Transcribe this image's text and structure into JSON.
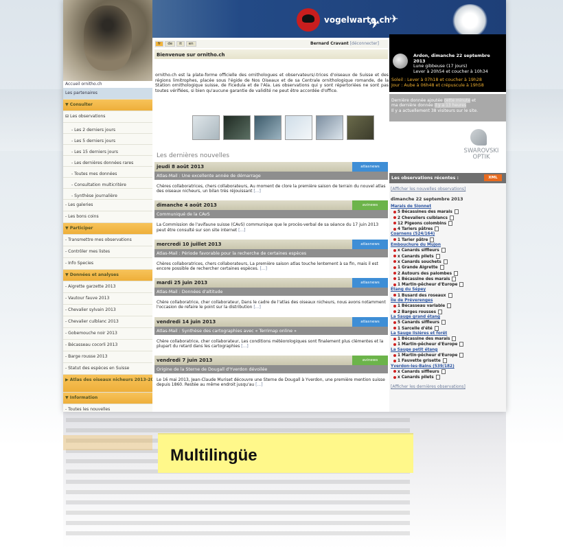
{
  "header": {
    "brand": "vogelwarte.ch"
  },
  "langbar": {
    "languages": [
      "fr",
      "de",
      "it",
      "en"
    ],
    "user": "Bernard Cravant",
    "logout": "[déconnecter]"
  },
  "welcome": {
    "title": "Bienvenue sur ornitho.ch",
    "intro": "ornitho.ch est la plate-forme officielle des ornithologues et observateurs/-trices d'oiseaux de Suisse et des régions limitrophes, placée sous l'égide de Nos Oiseaux et de sa Centrale ornithologique romande, de la Station ornithologique suisse, de Ficedula et de l'Ala. Les observations qui y sont répertoriées ne sont pas toutes vérifiées, si bien qu'aucune garantie de validité ne peut être accordée d'office."
  },
  "nav": {
    "home": "Accueil ornitho.ch",
    "partners": "Les partenaires",
    "consulter": "▼ Consulter",
    "observations": "⊟ Les observations",
    "items1": [
      "- Les 2 derniers jours",
      "- Les 5 derniers jours",
      "- Les 15 derniers jours",
      "- Les dernières données rares",
      "- Toutes mes données",
      "- Consultation multicritère",
      "- Synthèse journalière"
    ],
    "galleries": "- Les galeries",
    "bonscoins": "- Les bons coins",
    "participer": "▼ Participer",
    "items2": [
      "- Transmettre mes observations",
      "- Contrôler mes listes",
      "- Info Species"
    ],
    "donnees": "▼ Données et analyses",
    "items3": [
      "- Aigrette garzette 2013",
      "- Vautour fauve 2013",
      "- Chevalier sylvain 2013",
      "- Chevalier culblanc 2013",
      "- Gobemouche noir 2013",
      "- Bécasseau cocorli 2013",
      "- Barge rousse 2013",
      "- Statut des espèces en Suisse"
    ],
    "atlas": "▶ Atlas des oiseaux nicheurs 2013-2016",
    "information": "▼ Information",
    "items4": [
      "- Toutes les nouvelles"
    ]
  },
  "news": {
    "title": "Les dernières nouvelles",
    "more": "[...]",
    "items": [
      {
        "date": "jeudi 8 août 2013",
        "tag": "atlasnews",
        "sub": "Atlas-Mail : Une excellente année de démarrage",
        "body": "Chères collaboratrices, chers collaborateurs, Au moment de clore la première saison de terrain du nouvel atlas des oiseaux nicheurs, un bilan très réjouissant"
      },
      {
        "date": "dimanche 4 août 2013",
        "tag": "avinews",
        "sub": "Communiqué de la CAvS",
        "body": "La Commission de l'avifaune suisse (CAvS) communique que le procès-verbal de sa séance du 17 juin 2013 peut être consulté sur son site internet"
      },
      {
        "date": "mercredi 10 juillet 2013",
        "tag": "atlasnews",
        "sub": "Atlas-Mail : Période favorable pour la recherche de certaines espèces",
        "body": "Chères collaboratrices, chers collaborateurs, La première saison atlas touche lentement à sa fin, mais il est encore possible de rechercher certaines espèces."
      },
      {
        "date": "mardi 25 juin 2013",
        "tag": "atlasnews",
        "sub": "Atlas-Mail : Données d'altitude",
        "body": "Chère collaboratrice, cher collaborateur, Dans le cadre de l'atlas des oiseaux nicheurs, nous avons notamment l'occasion de refaire le point sur la distribution"
      },
      {
        "date": "vendredi 14 juin 2013",
        "tag": "atlasnews",
        "sub": "Atlas-Mail : Synthèse des cartographies avec « Terrimap online »",
        "body": "Chère collaboratrice, cher collaborateur, Les conditions météorologiques sont finalement plus clémentes et la plupart du retard dans les cartographies"
      },
      {
        "date": "vendredi 7 juin 2013",
        "tag": "avinews",
        "sub": "Origine de la Sterne de Dougall d'Yverdon dévoilée",
        "body": "Le 16 mai 2013, Jean-Claude Muriset découvre une Sterne de Dougall à Yverdon, une première mention suisse depuis 1860. Restée au même endroit jusqu'au"
      }
    ]
  },
  "moon": {
    "place": "Ardon, dimanche 22 septembre 2013",
    "phase": "Lune gibbeuse (17 jours)",
    "moonrise": "Lever à 20h54 et coucher à 10h34",
    "sun": "Soleil : Lever à 07h18 et coucher à 19h28",
    "day": "Jour : Aube à 06h48 et crépuscule à 19h58"
  },
  "lastdata": {
    "line1a": "Dernière donnée ajoutée",
    "line1b": "cette minute",
    "line1c": "et",
    "line2a": "ma dernière donnée",
    "line2b": "il y a 13 heures",
    "line3": "Il y a actuellement 38 visiteurs sur le site."
  },
  "sponsor": {
    "name1": "SWAROVSKI",
    "name2": "OPTIK"
  },
  "obs": {
    "title": "Les observations récentes :",
    "xml": "XML",
    "showNew": "[Afficher les nouvelles observations]",
    "date": "dimanche 22 septembre 2013",
    "showLast": "[Afficher les dernières observations]",
    "groups": [
      {
        "loc": "Marais de Sionnet",
        "sp": [
          "5 Bécassines des marais",
          "2 Chevaliers culblancs",
          "12 Pigeons colombins",
          "4 Tariers pâtres"
        ]
      },
      {
        "loc": "Coarnens (524/164)",
        "sp": [
          "1 Tarier pâtre"
        ]
      },
      {
        "loc": "Embouchure du Mujon",
        "sp": [
          "x Canards siffleurs",
          "x Canards pilets",
          "x Canards souchets",
          "1 Grande Aigrette",
          "2 Autours des palombes",
          "1 Bécassine des marais",
          "1 Martin-pêcheur d'Europe"
        ]
      },
      {
        "loc": "Étang du Sépey",
        "sp": [
          "1 Busard des roseaux"
        ]
      },
      {
        "loc": "Île de Préverenges",
        "sp": [
          "1 Bécasseau variable",
          "2 Barges rousses"
        ]
      },
      {
        "loc": "La Sauge grand étang",
        "sp": [
          "5 Canards siffleurs",
          "1 Sarcelle d'été"
        ]
      },
      {
        "loc": "La Sauge lisières et forêt",
        "sp": [
          "1 Bécassine des marais",
          "1 Martin-pêcheur d'Europe"
        ]
      },
      {
        "loc": "La Sauge petit étang",
        "sp": [
          "1 Martin-pêcheur d'Europe",
          "1 Fauvette grisette"
        ]
      },
      {
        "loc": "Yverdon-les-Bains (539/182)",
        "sp": [
          "x Canards siffleurs",
          "x Canards pilets"
        ]
      }
    ]
  },
  "banner": {
    "text": "Multilingüe"
  }
}
